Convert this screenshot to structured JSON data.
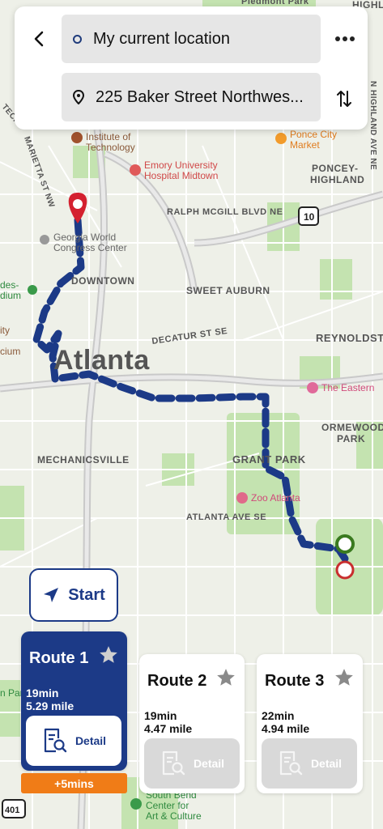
{
  "search": {
    "origin": "My current location",
    "destination": "225 Baker Street Northwes..."
  },
  "map": {
    "city": "Atlanta",
    "labels": {
      "downtown": "DOWNTOWN",
      "sweet_auburn": "SWEET AUBURN",
      "grant_park": "GRANT PARK",
      "mechanicsville": "MECHANICSVILLE",
      "reynoldstown": "REYNOLDSTOW",
      "ormewood": "ORMEWOOD",
      "ormewood2": "PARK",
      "poncey": "PONCEY-",
      "poncey2": "HIGHLAND",
      "ralph": "RALPH MCGILL BLVD NE",
      "decatur": "DECATUR ST SE",
      "atlanta_ave": "ATLANTA AVE SE",
      "marietta": "MARIETTA ST NW",
      "highland_top": "HIGHLAND",
      "highland_right": "N HIGHLAND AVE NE",
      "piedmont": "Piedmont Park",
      "tech_left": "TECH",
      "ponce_city": "Ponce City",
      "ponce_city2": "Market",
      "inst_tech": "Institute of",
      "inst_tech2": "Technology",
      "emory": "Emory University",
      "emory2": "Hospital Midtown",
      "gwcc": "Georgia World",
      "gwcc2": "Congress Center",
      "zoo": "Zoo Atlanta",
      "eastern": "The Eastern",
      "southbend": "South Bend",
      "southbend2": "Center for",
      "southbend3": "Art & Culture",
      "highway_10": "10",
      "highway_401": "401",
      "des": "des-",
      "dium": "dium",
      "ity": "ity",
      "cium": "cium",
      "park_left": "n Park"
    }
  },
  "start_label": "Start",
  "routes": [
    {
      "name": "Route 1",
      "time": "19min",
      "distance": "5.29 mile",
      "detail": "Detail",
      "extra": "+5mins"
    },
    {
      "name": "Route 2",
      "time": "19min",
      "distance": "4.47 mile",
      "detail": "Detail"
    },
    {
      "name": "Route 3",
      "time": "22min",
      "distance": "4.94 mile",
      "detail": "Detail"
    }
  ],
  "colors": {
    "route": "#1c3a87",
    "accent_orange": "#f07c17",
    "origin_pin": "#d42130",
    "dest_green": "#3a7a1f"
  }
}
